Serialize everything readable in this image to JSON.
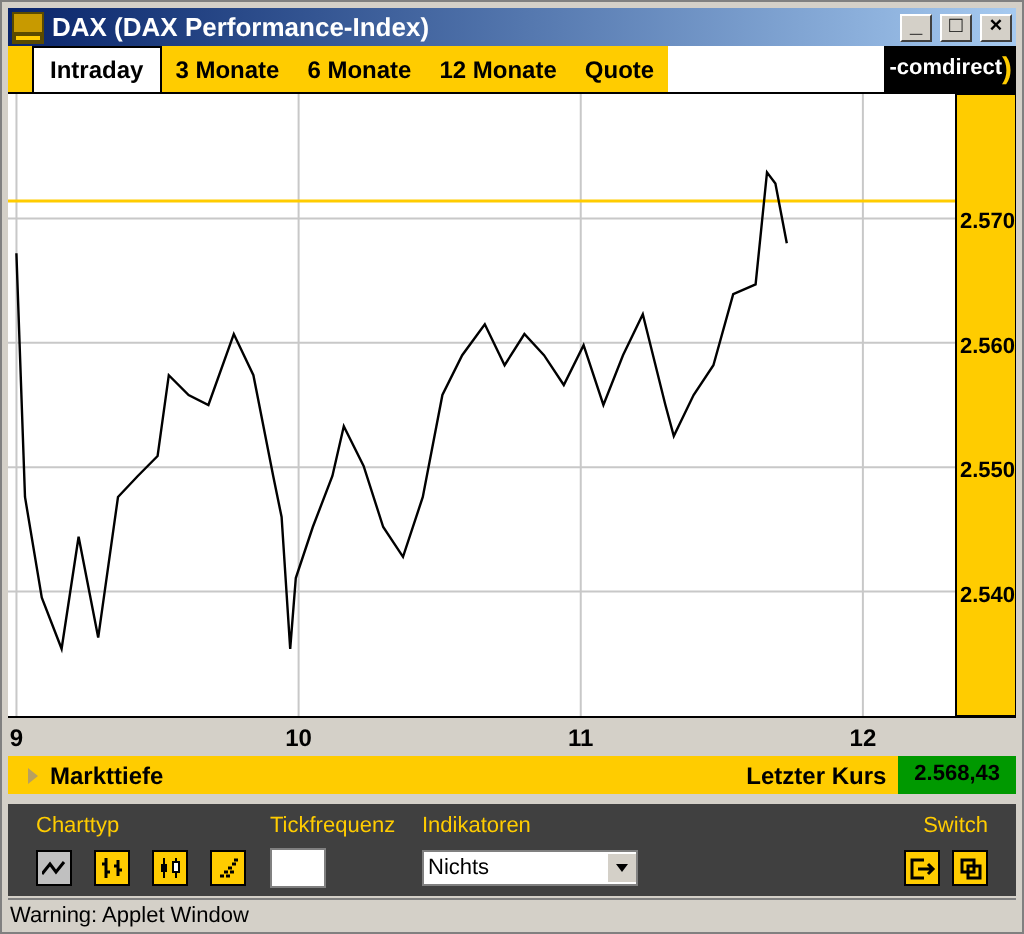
{
  "window": {
    "title": "DAX (DAX Performance-Index)",
    "controls": [
      "_",
      "□",
      "×"
    ]
  },
  "tabs": [
    {
      "label": "Intraday",
      "selected": true
    },
    {
      "label": "3 Monate",
      "selected": false
    },
    {
      "label": "6 Monate",
      "selected": false
    },
    {
      "label": "12 Monate",
      "selected": false
    },
    {
      "label": "Quote",
      "selected": false
    }
  ],
  "logo": {
    "text": "-comdirect",
    "mark": ")"
  },
  "chart_data": {
    "type": "line",
    "xlim": [
      8.97,
      12.33
    ],
    "ylim": [
      2530,
      2580
    ],
    "xticks": [
      9,
      10,
      11,
      12
    ],
    "yticks": [
      {
        "value": 2540,
        "label": "2.540"
      },
      {
        "value": 2550,
        "label": "2.550"
      },
      {
        "value": 2560,
        "label": "2.560"
      },
      {
        "value": 2570,
        "label": "2.570"
      }
    ],
    "x": [
      9.0,
      9.03,
      9.09,
      9.16,
      9.22,
      9.29,
      9.36,
      9.43,
      9.5,
      9.54,
      9.61,
      9.68,
      9.77,
      9.84,
      9.91,
      9.94,
      9.97,
      9.99,
      10.05,
      10.12,
      10.16,
      10.23,
      10.3,
      10.37,
      10.44,
      10.51,
      10.58,
      10.66,
      10.73,
      10.8,
      10.87,
      10.94,
      11.01,
      11.08,
      11.15,
      11.22,
      11.3,
      11.33,
      11.4,
      11.47,
      11.54,
      11.62,
      11.66,
      11.69,
      11.73
    ],
    "grid": true,
    "series": [
      {
        "color": "#000000",
        "values": [
          2567.2,
          2547.6,
          2539.5,
          2535.4,
          2544.4,
          2536.3,
          2547.6,
          2549.3,
          2550.9,
          2557.4,
          2555.8,
          2555.0,
          2560.7,
          2557.4,
          2549.3,
          2546.0,
          2535.4,
          2541.1,
          2545.2,
          2549.3,
          2553.3,
          2550.1,
          2545.2,
          2542.8,
          2547.6,
          2555.8,
          2559.0,
          2561.5,
          2558.2,
          2560.7,
          2559.0,
          2556.6,
          2559.8,
          2555.0,
          2559.0,
          2562.3,
          2555.0,
          2552.5,
          2555.8,
          2558.2,
          2563.9,
          2564.7,
          2573.7,
          2572.8,
          2568.0
        ]
      }
    ],
    "ref_lines": [
      {
        "axis": "y",
        "value": 2571.4,
        "color": "#ffcc00"
      }
    ]
  },
  "info_bar": {
    "label": "Markttiefe",
    "last_price_label": "Letzter Kurs",
    "last_price": "2.568,43"
  },
  "toolbar": {
    "chart_type_label": "Charttyp",
    "chart_types": [
      {
        "kind": "line",
        "selected": true
      },
      {
        "kind": "ohlc",
        "selected": false
      },
      {
        "kind": "candle",
        "selected": false
      },
      {
        "kind": "dots",
        "selected": false
      }
    ],
    "tick_label": "Tickfrequenz",
    "indicator_label": "Indikatoren",
    "indicator_value": "Nichts",
    "switch_label": "Switch",
    "switch_buttons": [
      {
        "kind": "detach"
      },
      {
        "kind": "window"
      }
    ]
  },
  "status_bar": "Warning: Applet Window"
}
